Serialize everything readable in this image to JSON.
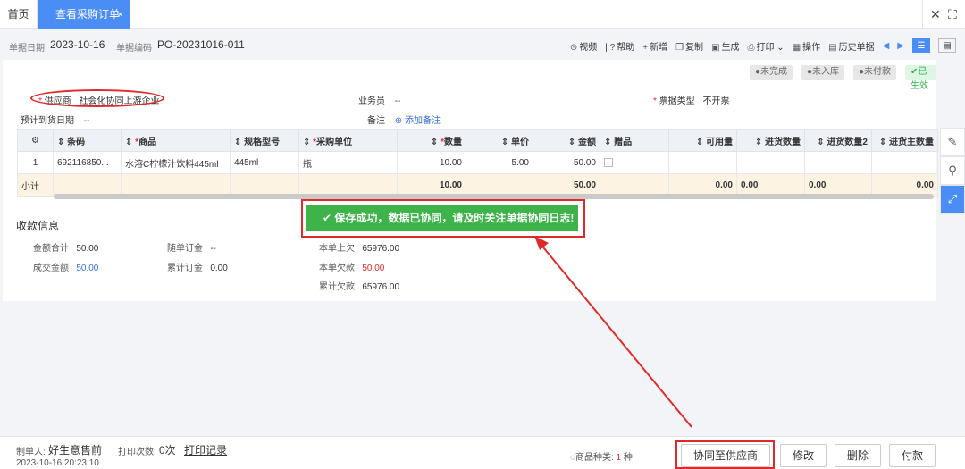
{
  "tabs": {
    "home": "首页",
    "active": "查看采购订单"
  },
  "header": {
    "date_label": "单据日期",
    "date_value": "2023-10-16",
    "code_label": "单据编码",
    "code_value": "PO-20231016-011"
  },
  "toolbar": {
    "video": "视频",
    "help": "帮助",
    "add": "新增",
    "copy": "复制",
    "generate": "生成",
    "print": "打印",
    "operate": "操作",
    "history": "历史单据"
  },
  "status_tags": [
    "未完成",
    "未入库",
    "未付款",
    "已生效"
  ],
  "form": {
    "supplier_label": "供应商",
    "supplier_value": "社会化协同上游企业",
    "salesman_label": "业务员",
    "salesman_value": "--",
    "invoice_label": "票据类型",
    "invoice_value": "不开票",
    "arrival_label": "预计到货日期",
    "arrival_value": "--",
    "remark_label": "备注",
    "add_remark": "添加备注"
  },
  "table": {
    "headers": [
      "条码",
      "商品",
      "规格型号",
      "采购单位",
      "数量",
      "单价",
      "金额",
      "赠品",
      "可用量",
      "进货数量",
      "进货数量2",
      "进货主数量"
    ],
    "rows": [
      {
        "idx": "1",
        "barcode": "692116850...",
        "product": "水溶C柠檬汁饮料445ml",
        "spec": "445ml",
        "unit": "瓶",
        "qty": "10.00",
        "price": "5.00",
        "amount": "50.00"
      }
    ],
    "subtotal": {
      "label": "小计",
      "qty": "10.00",
      "amount": "50.00",
      "avail": "0.00",
      "in_qty": "0.00",
      "in_qty2": "0.00",
      "in_main": "0.00"
    }
  },
  "toast": "保存成功，数据已协同，请及时关注单据协同日志!",
  "payment": {
    "title": "收款信息",
    "total_label": "金额合计",
    "total_value": "50.00",
    "deposit_label": "随单订金",
    "deposit_value": "--",
    "prev_owe_label": "本单上欠",
    "prev_owe_value": "65976.00",
    "deal_label": "成交金额",
    "deal_value": "50.00",
    "acc_deposit_label": "累计订金",
    "acc_deposit_value": "0.00",
    "cur_owe_label": "本单欠款",
    "cur_owe_value": "50.00",
    "acc_owe_label": "累计欠款",
    "acc_owe_value": "65976.00"
  },
  "footer": {
    "maker_label": "制单人:",
    "maker_value": "好生意售前",
    "print_count_label": "打印次数:",
    "print_count_value": "0次",
    "print_log": "打印记录",
    "timestamp": "2023-10-16 20:23:10",
    "kinds_label": "商品种类:",
    "kinds_value": "1",
    "kinds_unit": "种",
    "btn_sync": "协同至供应商",
    "btn_edit": "修改",
    "btn_delete": "删除",
    "btn_pay": "付款"
  },
  "colors": {
    "accent": "#4a8df5",
    "success": "#3db34a",
    "highlight": "#e02a2a"
  }
}
